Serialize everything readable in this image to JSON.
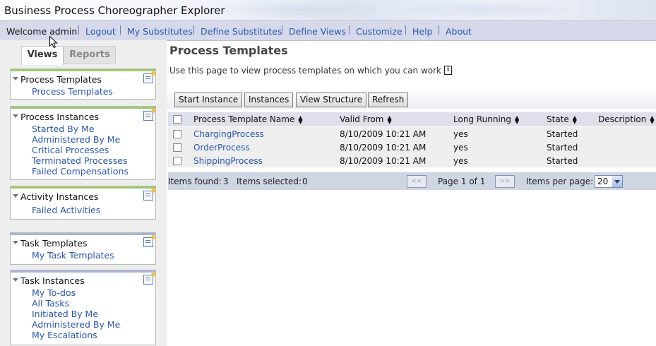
{
  "app": {
    "title": "Business Process Choreographer Explorer"
  },
  "nav": {
    "welcome": "Welcome admin",
    "items": [
      "Logout",
      "My Substitutes",
      "Define Substitutes",
      "Define Views",
      "Customize",
      "Help",
      "About"
    ]
  },
  "left": {
    "tabs": {
      "views": "Views",
      "reports": "Reports"
    },
    "sections": {
      "process_templates": {
        "title": "Process Templates",
        "items": [
          "Process Templates"
        ]
      },
      "process_instances": {
        "title": "Process Instances",
        "items": [
          "Started By Me",
          "Administered By Me",
          "Critical Processes",
          "Terminated Processes",
          "Failed Compensations"
        ]
      },
      "activity_instances": {
        "title": "Activity Instances",
        "items": [
          "Failed Activities"
        ]
      },
      "task_templates": {
        "title": "Task Templates",
        "items": [
          "My Task Templates"
        ]
      },
      "task_instances": {
        "title": "Task Instances",
        "items": [
          "My To-dos",
          "All Tasks",
          "Initiated By Me",
          "Administered By Me",
          "My Escalations"
        ]
      }
    }
  },
  "main": {
    "title": "Process Templates",
    "description": "Use this page to view process templates on which you can work",
    "info_icon": "i",
    "buttons": {
      "start_instance": "Start Instance",
      "instances": "Instances",
      "view_structure": "View Structure",
      "refresh": "Refresh"
    },
    "table": {
      "columns": [
        "Process Template Name",
        "Valid From",
        "Long Running",
        "State",
        "Description"
      ],
      "rows": [
        {
          "name": "ChargingProcess",
          "valid_from": "8/10/2009 10:21 AM",
          "long_running": "yes",
          "state": "Started",
          "description": ""
        },
        {
          "name": "OrderProcess",
          "valid_from": "8/10/2009 10:21 AM",
          "long_running": "yes",
          "state": "Started",
          "description": ""
        },
        {
          "name": "ShippingProcess",
          "valid_from": "8/10/2009 10:21 AM",
          "long_running": "yes",
          "state": "Started",
          "description": ""
        }
      ]
    },
    "footer": {
      "items_found_label": "Items found:",
      "items_found": "3",
      "items_selected_label": "Items selected:",
      "items_selected": "0",
      "prev": "<<",
      "next": ">>",
      "page": "Page 1 of 1",
      "per_page_label": "Items per page:",
      "per_page": "20"
    }
  },
  "colors": {
    "link": "#2a57b0",
    "nav_bg": "#d5d9ea",
    "accent_green": "#9dcb6a",
    "accent_blue": "#a9b5d8"
  }
}
